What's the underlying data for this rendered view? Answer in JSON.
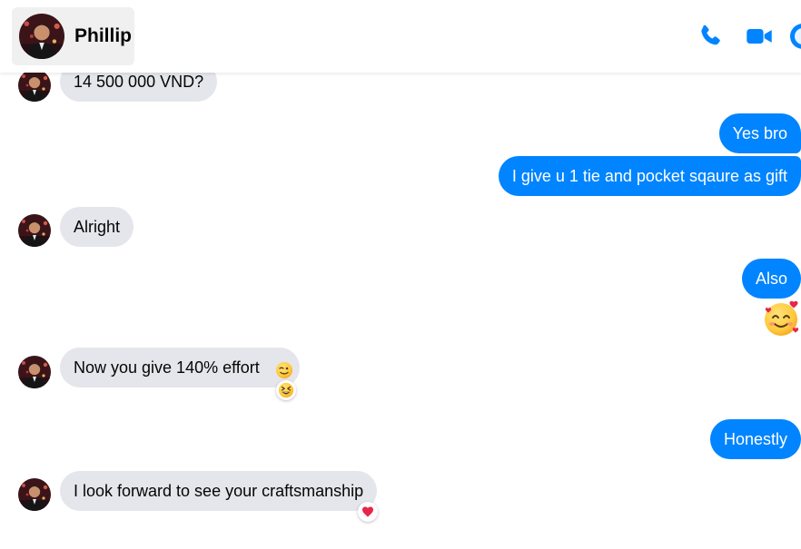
{
  "header": {
    "contact_name": "Phillip",
    "icons": [
      "phone-icon",
      "video-camera-icon",
      "info-icon"
    ],
    "accent_color": "#0084ff"
  },
  "messages": [
    {
      "side": "incoming",
      "text": "14 500 000 VND?"
    },
    {
      "side": "outgoing",
      "text": "Yes bro"
    },
    {
      "side": "outgoing",
      "text": "I give u 1 tie and pocket sqaure as gift"
    },
    {
      "side": "incoming",
      "text": "Alright"
    },
    {
      "side": "outgoing",
      "text": "Also"
    },
    {
      "side": "outgoing",
      "emoji": "smiling-face-with-hearts-emoji"
    },
    {
      "side": "incoming",
      "text": "Now you give 140% effort",
      "inline_emoji": "winking-face-emoji",
      "reaction": "grinning-squinting-face-emoji"
    },
    {
      "side": "outgoing",
      "text": "Honestly"
    },
    {
      "side": "incoming",
      "text": "I look forward to see your craftsmanship",
      "reaction": "red-heart-emoji"
    }
  ],
  "colors": {
    "incoming_bubble": "#e4e6eb",
    "outgoing_bubble": "#0084ff",
    "contact_chip_bg": "#f0f0f0"
  }
}
